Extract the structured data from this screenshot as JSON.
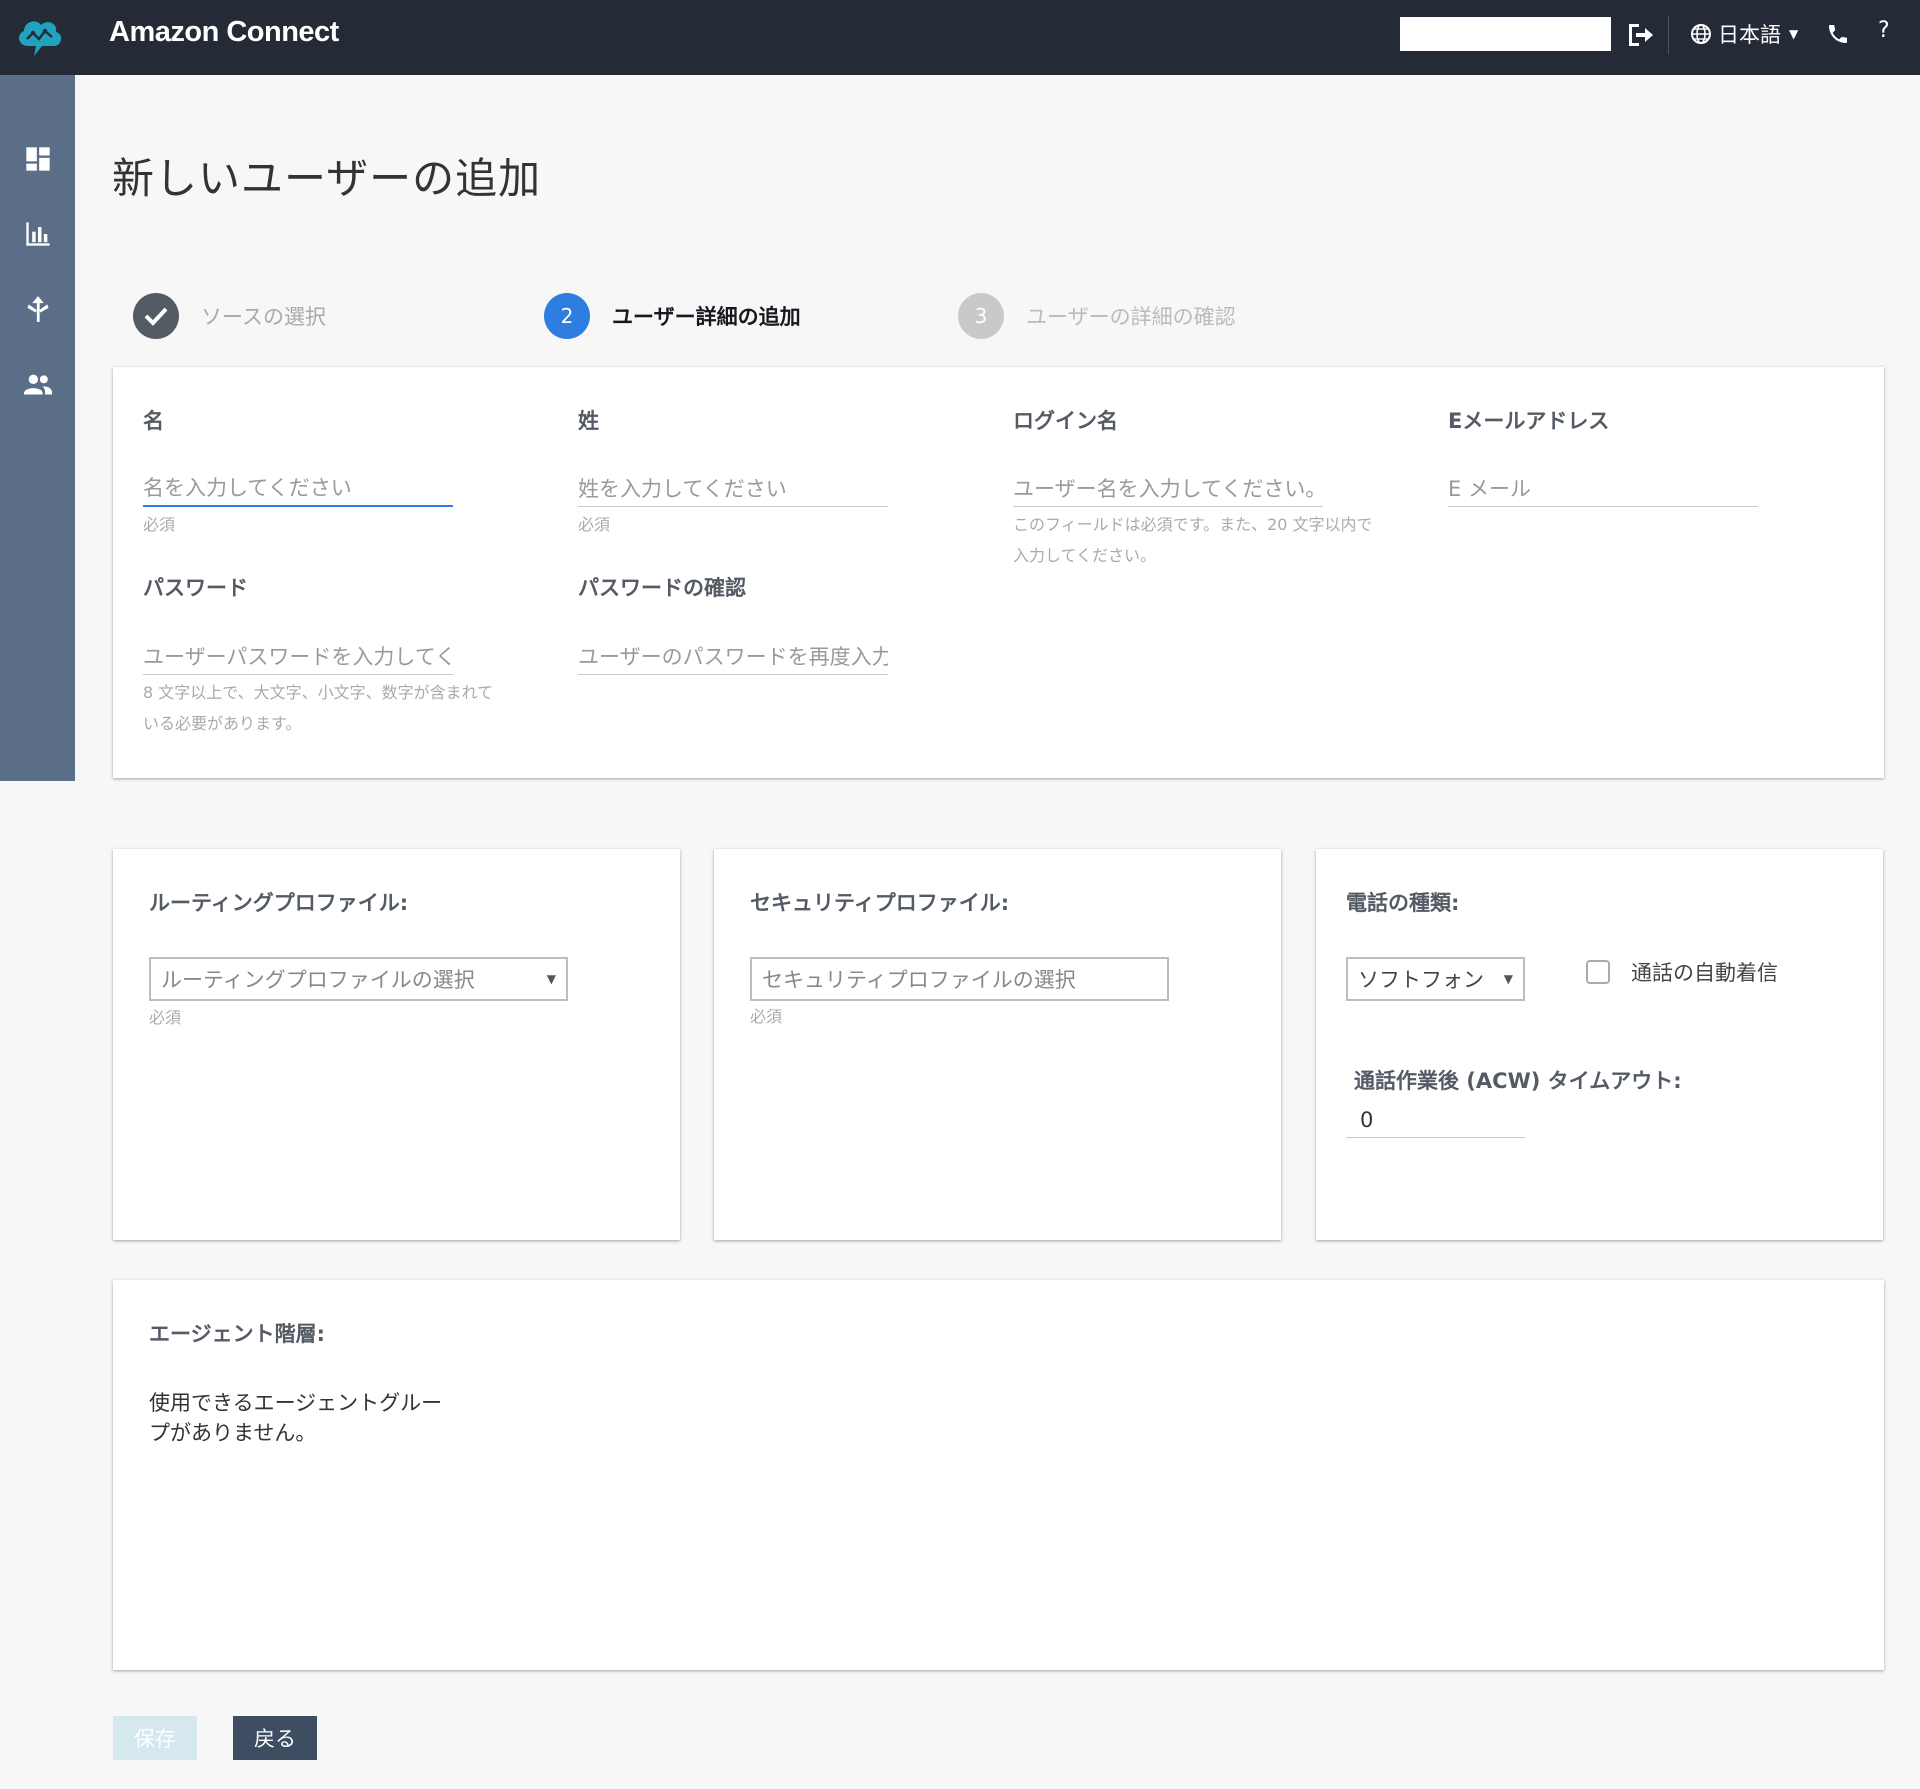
{
  "header": {
    "app_title": "Amazon Connect",
    "search_value": "",
    "language": "日本語",
    "help": "?",
    "icons": [
      "amazon-connect-logo-icon",
      "logout-icon",
      "globe-icon",
      "phone-icon"
    ]
  },
  "sidebar": {
    "items": [
      {
        "icon": "dashboard-icon"
      },
      {
        "icon": "metrics-icon"
      },
      {
        "icon": "routing-icon"
      },
      {
        "icon": "users-icon"
      }
    ]
  },
  "page": {
    "title": "新しいユーザーの追加"
  },
  "stepper": {
    "steps": [
      {
        "label": "ソースの選択",
        "state": "complete"
      },
      {
        "number": "2",
        "label": "ユーザー詳細の追加",
        "state": "current"
      },
      {
        "number": "3",
        "label": "ユーザーの詳細の確認",
        "state": "pending"
      }
    ]
  },
  "details": {
    "first_name": {
      "label": "名",
      "placeholder": "名を入力してください",
      "hint": "必須"
    },
    "last_name": {
      "label": "姓",
      "placeholder": "姓を入力してください",
      "hint": "必須"
    },
    "login": {
      "label": "ログイン名",
      "placeholder": "ユーザー名を入力してください。",
      "hint_line1": "このフィールドは必須です。また、20 文字以内で",
      "hint_line2": "入力してください。"
    },
    "email": {
      "label": "Eメールアドレス",
      "placeholder": "E メール"
    },
    "password": {
      "label": "パスワード",
      "placeholder": "ユーザーパスワードを入力してください",
      "hint_line1": "8 文字以上で、大文字、小文字、数字が含まれて",
      "hint_line2": "いる必要があります。"
    },
    "password_confirm": {
      "label": "パスワードの確認",
      "placeholder": "ユーザーのパスワードを再度入力してください"
    }
  },
  "routing": {
    "label": "ルーティングプロファイル:",
    "select_value": "ルーティングプロファイルの選択",
    "hint": "必須"
  },
  "security": {
    "label": "セキュリティプロファイル:",
    "select_value": "セキュリティプロファイルの選択",
    "hint": "必須"
  },
  "phone": {
    "label": "電話の種類:",
    "select_value": "ソフトフォン",
    "auto_accept_label": "通話の自動着信",
    "auto_accept_checked": false,
    "acw_label": "通話作業後 (ACW) タイムアウト:",
    "acw_value": "0"
  },
  "hierarchy": {
    "label": "エージェント階層:",
    "empty_line1": "使用できるエージェントグルー",
    "empty_line2": "プがありません。"
  },
  "actions": {
    "save": "保存",
    "back": "戻る"
  },
  "colors": {
    "header_bg": "#242b36",
    "sidebar_bg": "#5a6e87",
    "accent": "#2d7ee0",
    "back_button": "#3f4d62",
    "save_disabled": "#d5e8ee"
  }
}
